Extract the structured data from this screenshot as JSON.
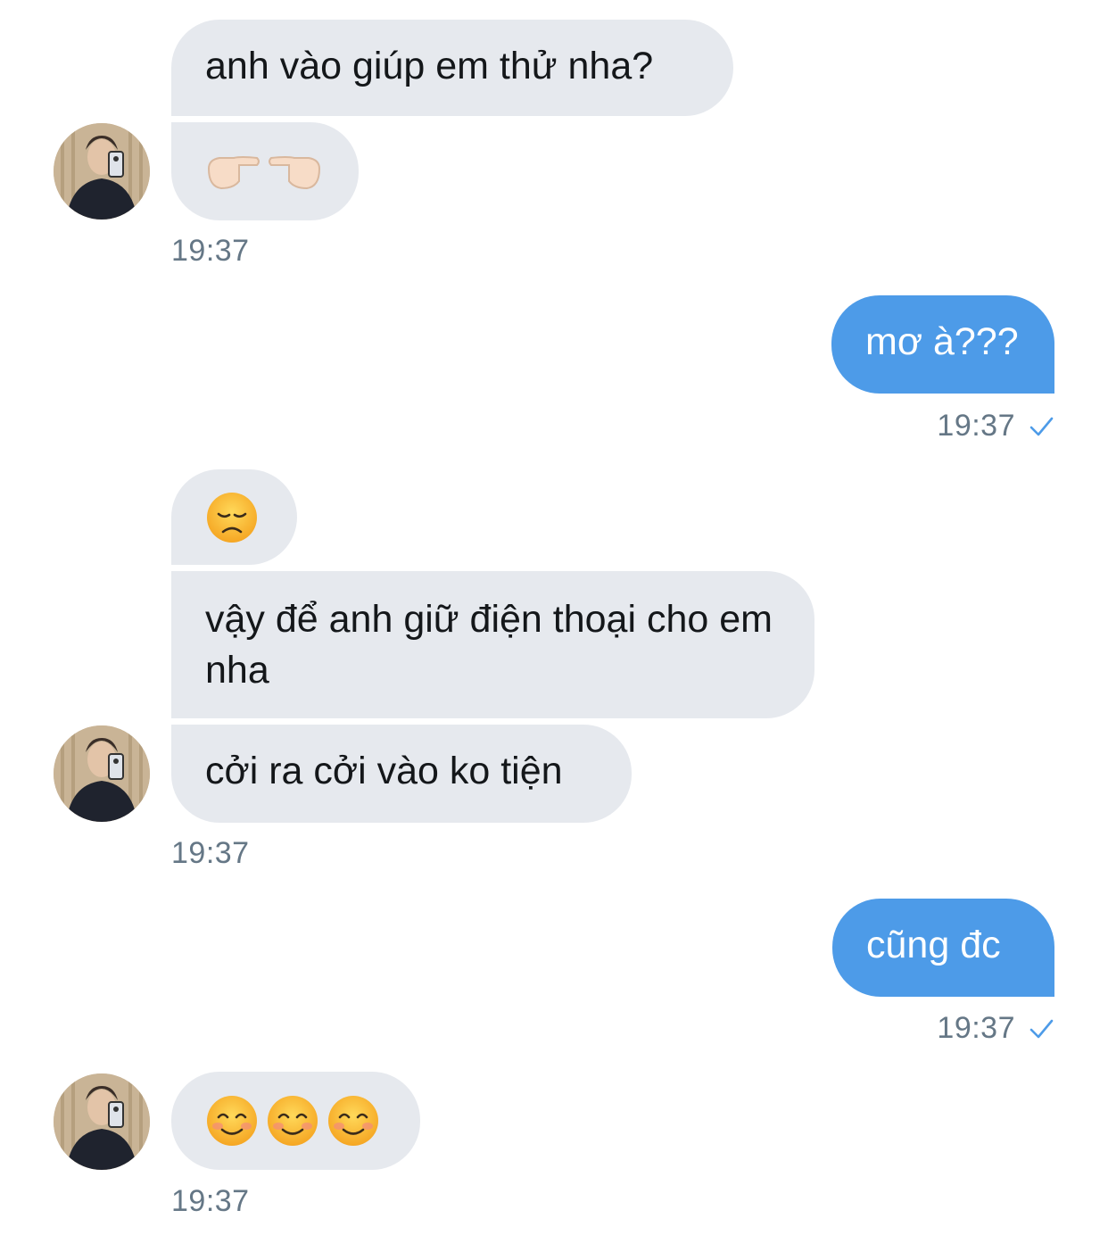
{
  "conversation": {
    "colors": {
      "incoming_bubble": "#e6e9ee",
      "outgoing_bubble": "#4d9be8",
      "timestamp": "#657786",
      "read_check": "#4d9be8"
    },
    "messages": [
      {
        "sender": "other",
        "text": "anh vào giúp em thử nha?"
      },
      {
        "sender": "other",
        "text": "👉👈"
      },
      {
        "sender": "other",
        "time": "19:37"
      },
      {
        "sender": "me",
        "text": "mơ à???",
        "time": "19:37",
        "status": "read-check-icon"
      },
      {
        "sender": "other",
        "text": "😞"
      },
      {
        "sender": "other",
        "text": "vậy để anh giữ điện thoại cho em nha"
      },
      {
        "sender": "other",
        "text": "cởi ra cởi vào ko tiện",
        "time": "19:37"
      },
      {
        "sender": "me",
        "text": "cũng đc",
        "time": "19:37",
        "status": "read-check-icon"
      },
      {
        "sender": "other",
        "text": "😊😊😊",
        "time": "19:37"
      }
    ]
  }
}
